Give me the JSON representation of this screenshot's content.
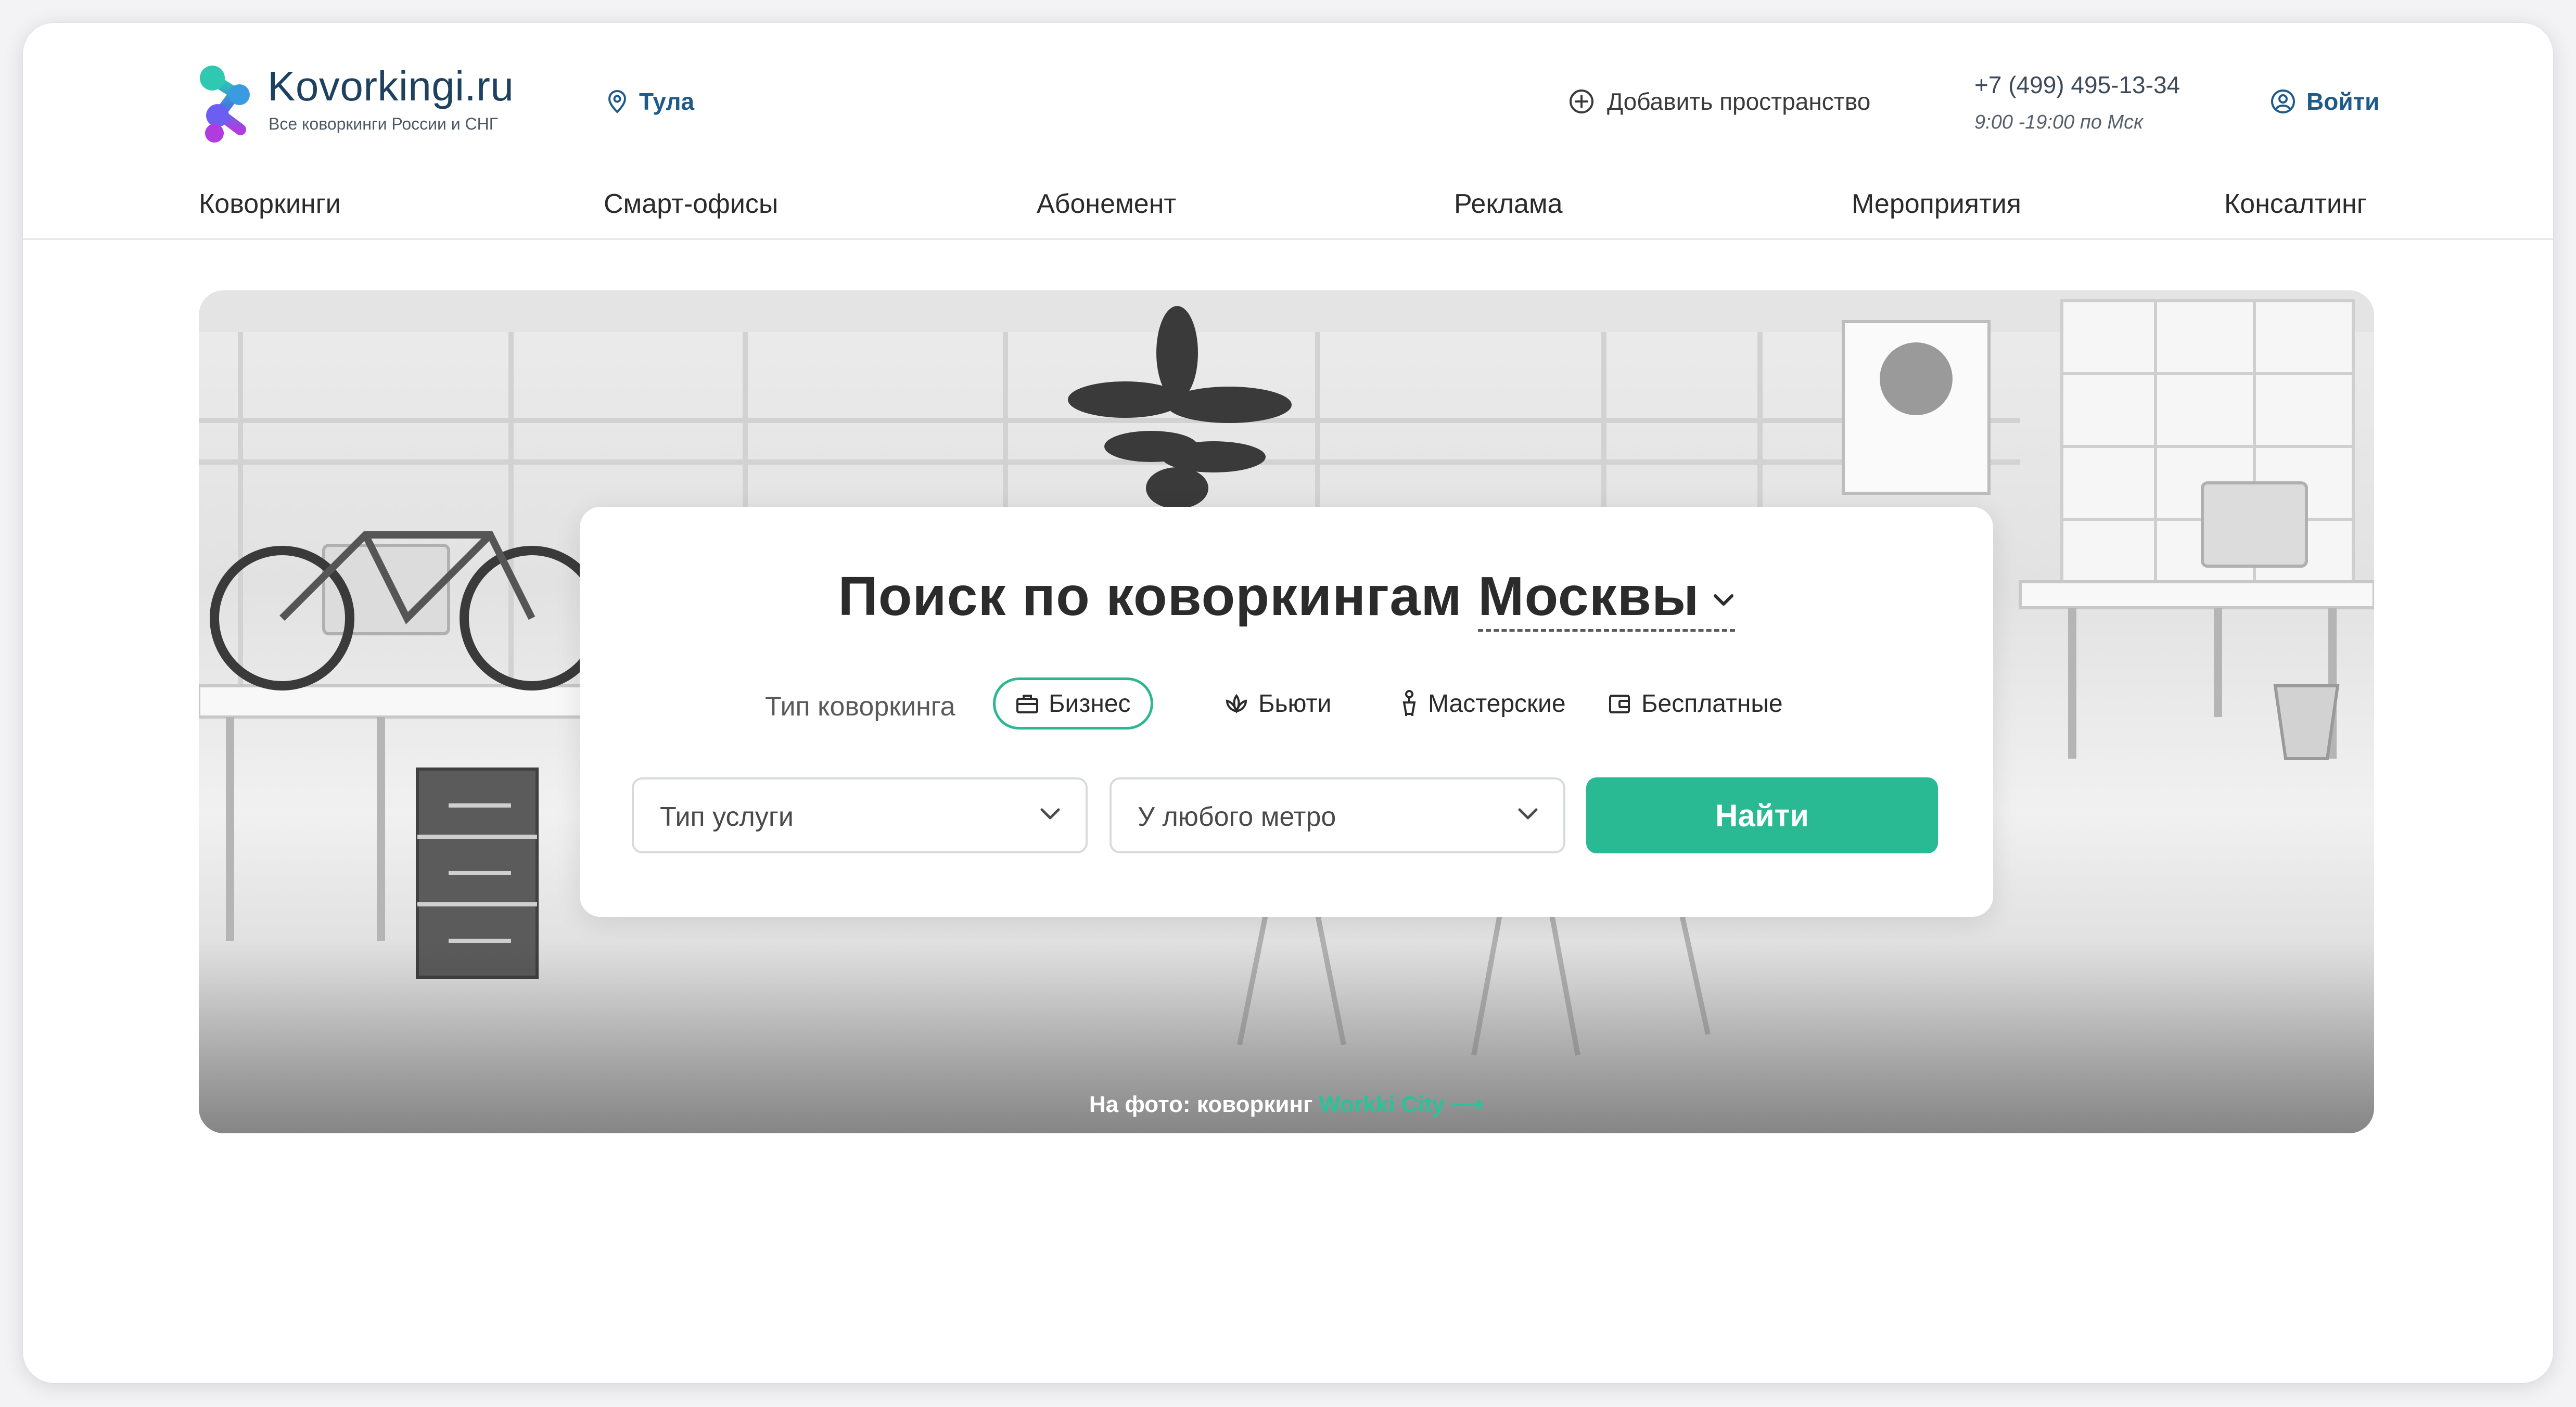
{
  "brand": {
    "name": "Kovorkingi.ru",
    "tagline": "Все коворкинги России и СНГ",
    "colors": {
      "accent": "#29b993",
      "link": "#1f5b8a",
      "logo_text": "#1f4160"
    }
  },
  "header": {
    "city": {
      "label": "Тула",
      "icon": "location-pin-icon"
    },
    "add_space": {
      "label": "Добавить пространство",
      "icon": "plus-circle-icon"
    },
    "phone": "+7 (499) 495-13-34",
    "hours": "9:00 -19:00 по Мск",
    "login": {
      "label": "Войти",
      "icon": "user-circle-icon"
    }
  },
  "nav": {
    "items": [
      {
        "label": "Коворкинги"
      },
      {
        "label": "Смарт-офисы"
      },
      {
        "label": "Абонемент"
      },
      {
        "label": "Реклама"
      },
      {
        "label": "Мероприятия"
      },
      {
        "label": "Консалтинг"
      }
    ]
  },
  "search": {
    "title_prefix": "Поиск по коворкингам",
    "city": "Москвы",
    "type_label": "Тип коворкинга",
    "types": [
      {
        "label": "Бизнес",
        "icon": "briefcase-icon",
        "active": true
      },
      {
        "label": "Бьюти",
        "icon": "lotus-icon",
        "active": false
      },
      {
        "label": "Мастерские",
        "icon": "figure-icon",
        "active": false
      },
      {
        "label": "Бесплатные",
        "icon": "wallet-icon",
        "active": false
      }
    ],
    "service_select": {
      "value": "Тип услуги"
    },
    "metro_select": {
      "value": "У любого метро"
    },
    "submit_label": "Найти"
  },
  "hero": {
    "caption_prefix": "На фото: коворкинг",
    "caption_link": "Workki City",
    "caption_arrow": "⟶"
  }
}
